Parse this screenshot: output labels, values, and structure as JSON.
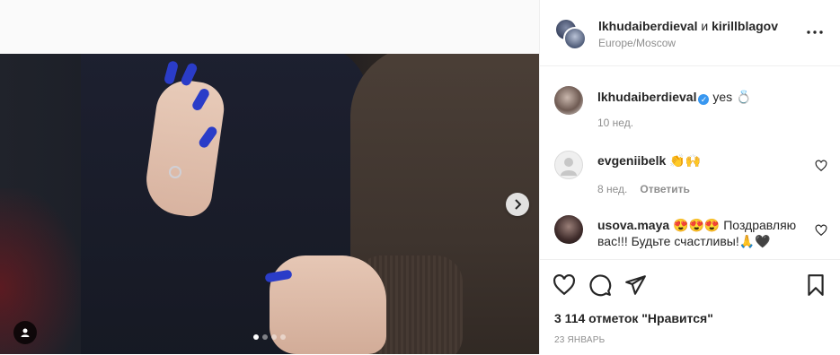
{
  "post": {
    "media": {
      "slide_count": 4,
      "active_slide": 1
    },
    "header": {
      "user1": "lkhudaiberdieval",
      "conjunction": "и",
      "user2": "kirillblagov",
      "location": "Europe/Moscow"
    },
    "caption": {
      "username": "lkhudaiberdieval",
      "text": "yes 💍",
      "time": "10 нед."
    },
    "comments": [
      {
        "username": "evgeniibelk",
        "text": "👏🙌",
        "time": "8 нед.",
        "reply_label": "Ответить"
      },
      {
        "username": "usova.maya",
        "text": "😍😍😍 Поздравляю вас!!! Будьте счастливы!🙏🖤"
      }
    ],
    "likes_text": "3 114 отметок \"Нравится\"",
    "date_text": "23 ЯНВАРЬ"
  },
  "colors": {
    "verified": "#3897f0",
    "nail": "#2a3cc8",
    "muted": "#8e8e8e"
  },
  "icons": [
    "more-icon",
    "verified-icon",
    "heart-icon",
    "comment-icon",
    "share-icon",
    "bookmark-icon",
    "chevron-right-icon",
    "user-tag-icon"
  ]
}
